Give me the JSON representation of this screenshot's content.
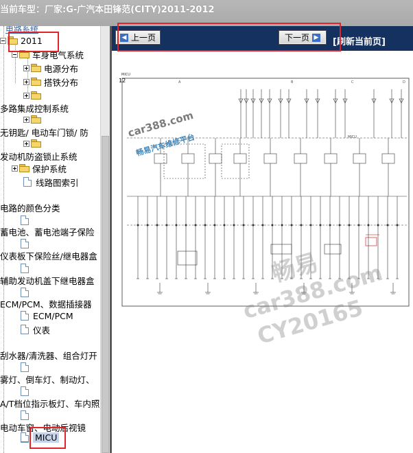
{
  "header": {
    "title": "当前车型：厂家:G-广汽本田锋范(CITY)2011-2012"
  },
  "tree": {
    "top_partial": "电路系统",
    "year": "2011",
    "items": [
      {
        "label": "车身电气系统"
      },
      {
        "label": "电源分布"
      },
      {
        "label": "搭铁分布"
      },
      {
        "label": ""
      },
      {
        "label": "多路集成控制系统"
      },
      {
        "label": "无钥匙/ 电动车门锁/ 防"
      },
      {
        "label": ""
      },
      {
        "label": "发动机防盗锁止系统"
      },
      {
        "label": "保护系统"
      },
      {
        "label": "线路图索引"
      },
      {
        "label": "电路的颜色分类"
      },
      {
        "label": "蓄电池、蓄电池端子保险"
      },
      {
        "label": "仪表板下保险丝/继电器盒"
      },
      {
        "label": "辅助发动机盖下继电器盒"
      },
      {
        "label": "ECM/PCM、数据插接器"
      },
      {
        "label": "ECM/PCM"
      },
      {
        "label": "仪表"
      },
      {
        "label": "刮水器/清洗器、组合灯开"
      },
      {
        "label": "雾灯、倒车灯、制动灯、"
      },
      {
        "label": "A/T档位指示板灯、车内照"
      },
      {
        "label": "电动车窗、电动后视镜"
      },
      {
        "label": "MICU"
      }
    ]
  },
  "nav": {
    "prev_label": "上一页",
    "next_label": "下一页",
    "refresh_label": "[刷新当前页]"
  },
  "diagram": {
    "page_number": "12",
    "unit_label": "MICU",
    "columns": [
      "A",
      "B",
      "C",
      "D"
    ],
    "watermarks": [
      "car388.com",
      "畅易汽车维修平台",
      "畅易",
      "car388.com",
      "CY20165"
    ]
  },
  "colors": {
    "nav_bg": "#14315f",
    "highlight": "#e0242b",
    "title_bg": "#aeaeae"
  }
}
